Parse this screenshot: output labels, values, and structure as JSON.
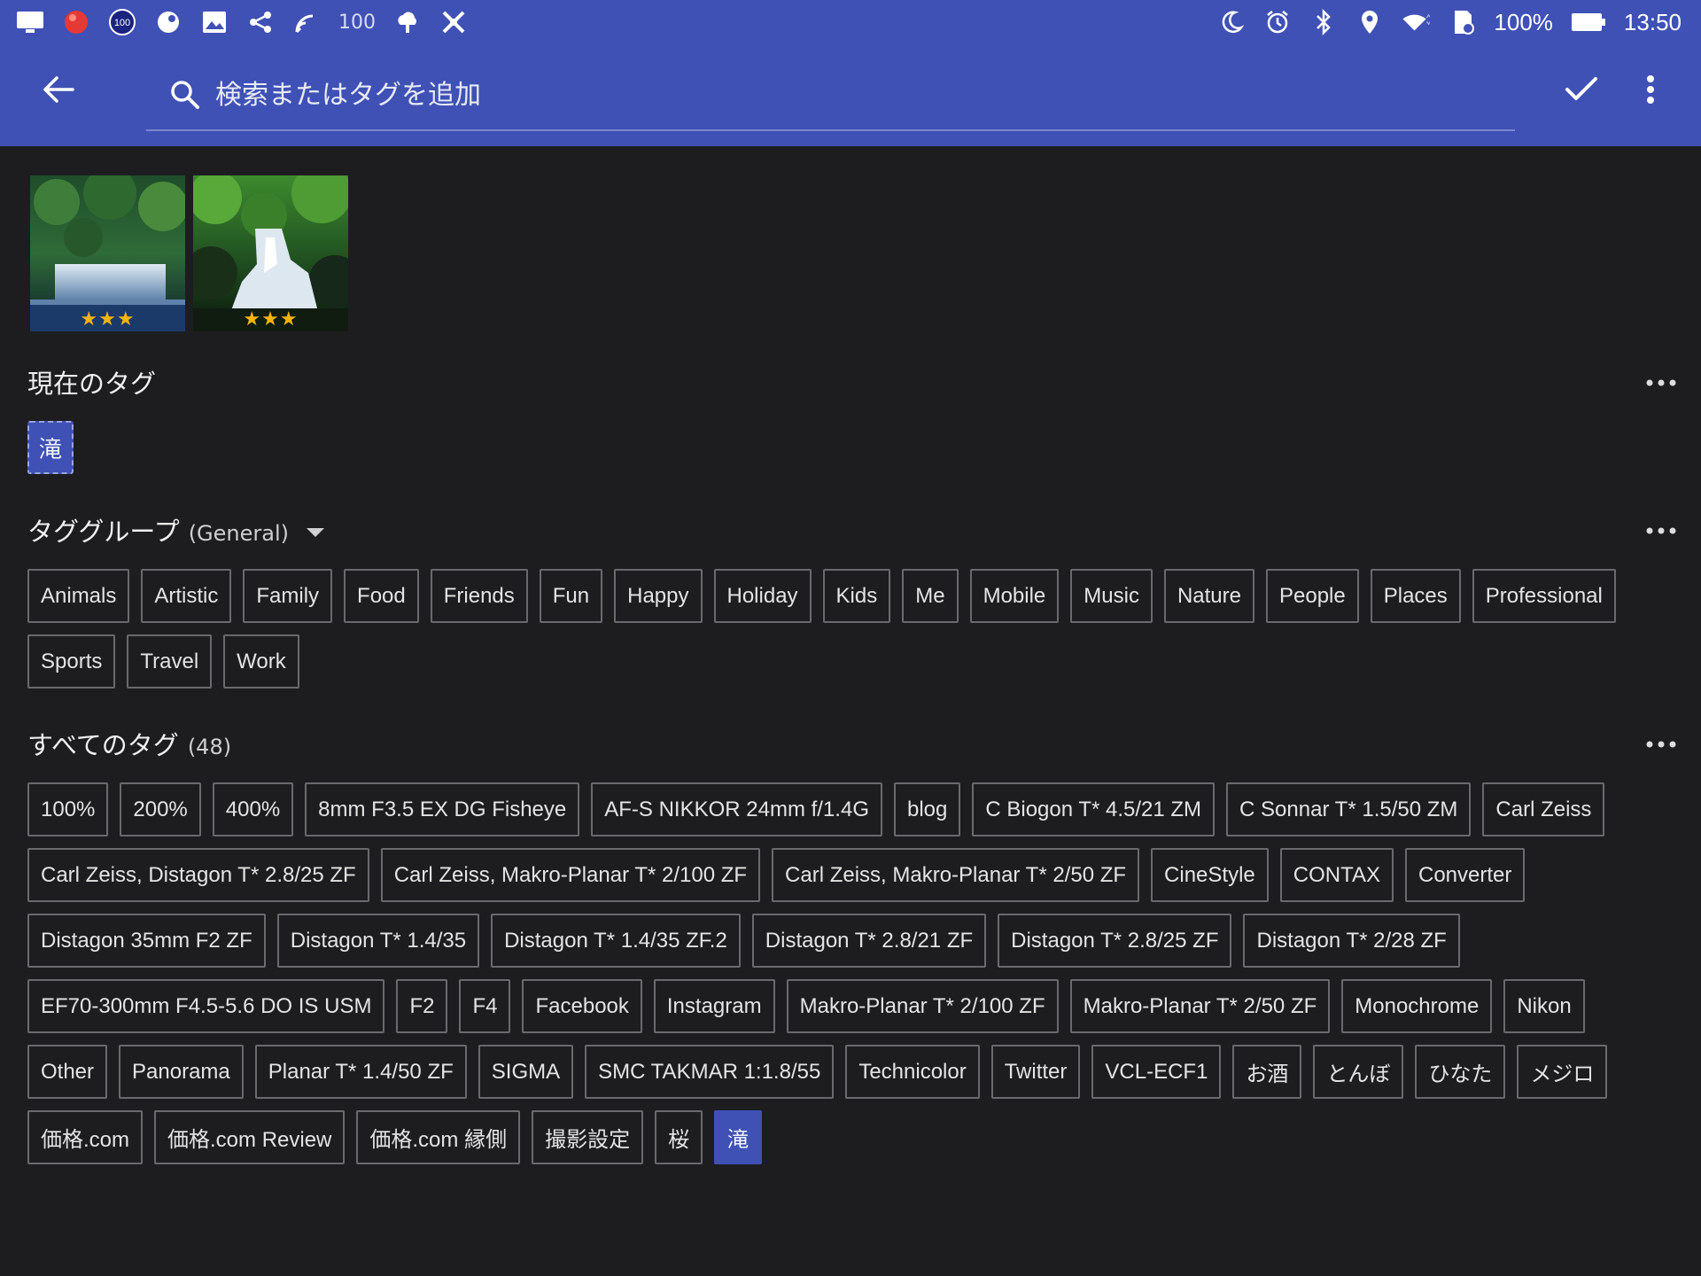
{
  "status_bar": {
    "left_icons": [
      "monitor-icon",
      "ball-icon",
      "badge-100-icon",
      "wrench-icon",
      "image-icon",
      "share-icon",
      "signal-icon"
    ],
    "left_text": "100",
    "left_icons_after": [
      "cloud-icon",
      "satellite-icon"
    ],
    "right_icons": [
      "moon-icon",
      "alarm-icon",
      "bluetooth-icon",
      "location-icon",
      "wifi-icon",
      "sd-card-icon"
    ],
    "battery_percent": "100%",
    "time": "13:50"
  },
  "app_bar": {
    "search_placeholder": "検索またはタグを追加",
    "accent_color": "#3f51b5"
  },
  "thumbnails": [
    {
      "stars": "★★★",
      "rating": 3
    },
    {
      "stars": "★★★",
      "rating": 3
    }
  ],
  "current_tags": {
    "title": "現在のタグ",
    "tags": [
      "滝"
    ]
  },
  "tag_group": {
    "title": "タググループ",
    "group_name": "(General)",
    "tags": [
      "Animals",
      "Artistic",
      "Family",
      "Food",
      "Friends",
      "Fun",
      "Happy",
      "Holiday",
      "Kids",
      "Me",
      "Mobile",
      "Music",
      "Nature",
      "People",
      "Places",
      "Professional",
      "Sports",
      "Travel",
      "Work"
    ]
  },
  "all_tags": {
    "title": "すべてのタグ",
    "count": "(48)",
    "tags": [
      "100%",
      "200%",
      "400%",
      "8mm F3.5 EX DG Fisheye",
      "AF-S NIKKOR 24mm f/1.4G",
      "blog",
      "C Biogon T* 4.5/21 ZM",
      "C Sonnar T* 1.5/50 ZM",
      "Carl Zeiss",
      "Carl Zeiss, Distagon T* 2.8/25 ZF",
      "Carl Zeiss, Makro-Planar T* 2/100 ZF",
      "Carl Zeiss, Makro-Planar T* 2/50 ZF",
      "CineStyle",
      "CONTAX",
      "Converter",
      "Distagon 35mm F2 ZF",
      "Distagon T* 1.4/35",
      "Distagon T* 1.4/35 ZF.2",
      "Distagon T* 2.8/21 ZF",
      "Distagon T* 2.8/25 ZF",
      "Distagon T* 2/28 ZF",
      "EF70-300mm F4.5-5.6 DO IS USM",
      "F2",
      "F4",
      "Facebook",
      "Instagram",
      "Makro-Planar T* 2/100 ZF",
      "Makro-Planar T* 2/50 ZF",
      "Monochrome",
      "Nikon",
      "Other",
      "Panorama",
      "Planar T* 1.4/50 ZF",
      "SIGMA",
      "SMC TAKMAR 1:1.8/55",
      "Technicolor",
      "Twitter",
      "VCL-ECF1",
      "お酒",
      "とんぼ",
      "ひなた",
      "メジロ",
      "価格.com",
      "価格.com Review",
      "価格.com 縁側",
      "撮影設定",
      "桜",
      "滝"
    ],
    "selected": [
      "滝"
    ]
  }
}
